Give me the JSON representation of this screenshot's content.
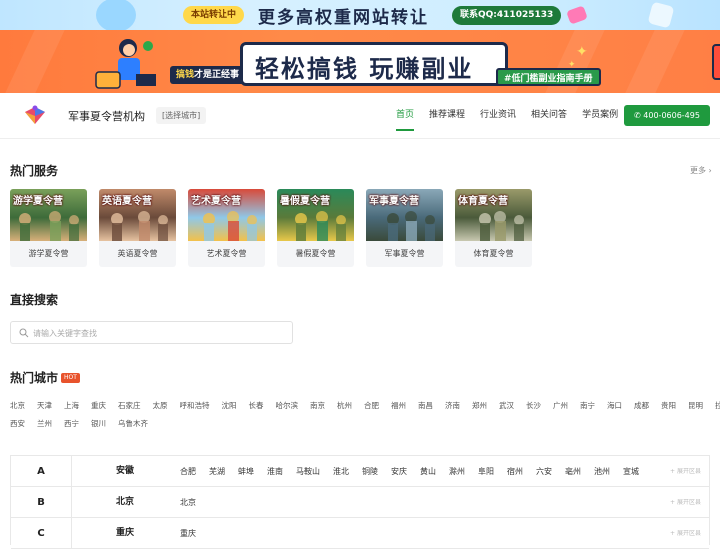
{
  "top_banner": {
    "badge": "本站转让中",
    "slogan": "更多高权重网站转让",
    "qq": "联系QQ:411025133"
  },
  "ad_banner": {
    "tagline_prefix": "搞钱",
    "tagline_rest": "才是正经事!",
    "headline": "轻松搞钱 玩赚副业",
    "manual": "#低门槛副业指南手册"
  },
  "header": {
    "site_name": "军事夏令营机构",
    "city_button": "[选择城市]",
    "nav": [
      "首页",
      "推荐课程",
      "行业资讯",
      "相关问答",
      "学员案例"
    ],
    "phone": "400-0606-495"
  },
  "hot_services": {
    "title": "热门服务",
    "more": "更多",
    "items": [
      {
        "overlay": "游学夏令营",
        "caption": "游学夏令营",
        "colors": [
          "#3d6b3a",
          "#7aa05a",
          "#d8b07a"
        ]
      },
      {
        "overlay": "英语夏令营",
        "caption": "英语夏令营",
        "colors": [
          "#6a4a3a",
          "#c08a6a",
          "#e6c2a0"
        ]
      },
      {
        "overlay": "艺术夏令营",
        "caption": "艺术夏令营",
        "colors": [
          "#8fc8e8",
          "#d84a3a",
          "#f3c14a"
        ]
      },
      {
        "overlay": "暑假夏令营",
        "caption": "暑假夏令营",
        "colors": [
          "#5a7a3a",
          "#2a8a5a",
          "#e8c84a"
        ]
      },
      {
        "overlay": "军事夏令营",
        "caption": "军事夏令营",
        "colors": [
          "#4a6a7a",
          "#8aa8b8",
          "#3a4a3a"
        ]
      },
      {
        "overlay": "体育夏令营",
        "caption": "体育夏令营",
        "colors": [
          "#4a5a3a",
          "#9a9a6a",
          "#c8c8b0"
        ]
      }
    ]
  },
  "direct_search": {
    "title": "直接搜索",
    "placeholder": "请输入关键字查找"
  },
  "hot_cities": {
    "title": "热门城市",
    "badge": "HOT",
    "row1": [
      "北京",
      "天津",
      "上海",
      "重庆",
      "石家庄",
      "太原",
      "呼和浩特",
      "沈阳",
      "长春",
      "哈尔滨",
      "南京",
      "杭州",
      "合肥",
      "福州",
      "南昌",
      "济南",
      "郑州",
      "武汉",
      "长沙",
      "广州",
      "南宁",
      "海口",
      "成都",
      "贵阳",
      "昆明",
      "拉萨"
    ],
    "row2": [
      "西安",
      "兰州",
      "西宁",
      "银川",
      "乌鲁木齐"
    ]
  },
  "city_table": {
    "expand_label": "展开区县",
    "rows": [
      {
        "letter": "A",
        "province": "安徽",
        "cities": [
          "合肥",
          "芜湖",
          "蚌埠",
          "淮南",
          "马鞍山",
          "淮北",
          "铜陵",
          "安庆",
          "黄山",
          "滁州",
          "阜阳",
          "宿州",
          "六安",
          "亳州",
          "池州",
          "宣城"
        ]
      },
      {
        "letter": "B",
        "province": "北京",
        "cities": [
          "北京"
        ]
      },
      {
        "letter": "C",
        "province": "重庆",
        "cities": [
          "重庆"
        ]
      }
    ]
  }
}
